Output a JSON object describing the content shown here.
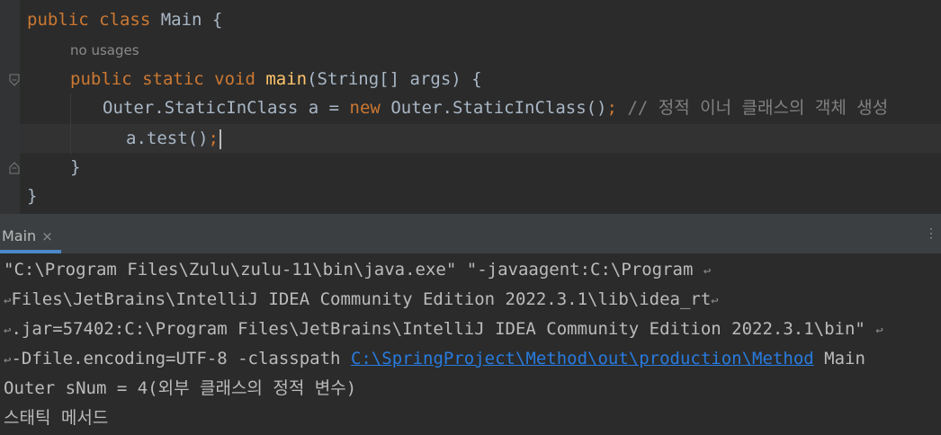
{
  "editor": {
    "line1": {
      "kw": "public class ",
      "name": "Main",
      "rest": " {"
    },
    "usage_hint": "no usages",
    "line2": {
      "kw": "public static void ",
      "fn": "main",
      "rest": "(String[] args) {"
    },
    "line3": {
      "code": "Outer.StaticInClass a = ",
      "kw": "new",
      "code2": " Outer.StaticInClass()",
      "semi": ";",
      "comment": " // 정적 이너 클래스의 객체 생성"
    },
    "line4": {
      "code": "a.test()",
      "semi": ";"
    },
    "line5": "}",
    "line6": "}"
  },
  "run_panel": {
    "tab_label": "Main",
    "close_glyph": "×",
    "menu_glyph": "⋮"
  },
  "console": {
    "wrap_glyph": "↩",
    "line1": "\"C:\\Program Files\\Zulu\\zulu-11\\bin\\java.exe\" \"-javaagent:C:\\Program",
    "line2": "Files\\JetBrains\\IntelliJ IDEA Community Edition 2022.3.1\\lib\\idea_rt",
    "line3": ".jar=57402:C:\\Program Files\\JetBrains\\IntelliJ IDEA Community Edition 2022.3.1\\bin\"",
    "line4_pre": "-Dfile.encoding=UTF-8 -classpath ",
    "line4_link": "C:\\SpringProject\\Method\\out\\production\\Method",
    "line4_post": " Main",
    "line5": "Outer sNum = 4(외부 클래스의 정적 변수)",
    "line6": "스태틱 메서드"
  }
}
